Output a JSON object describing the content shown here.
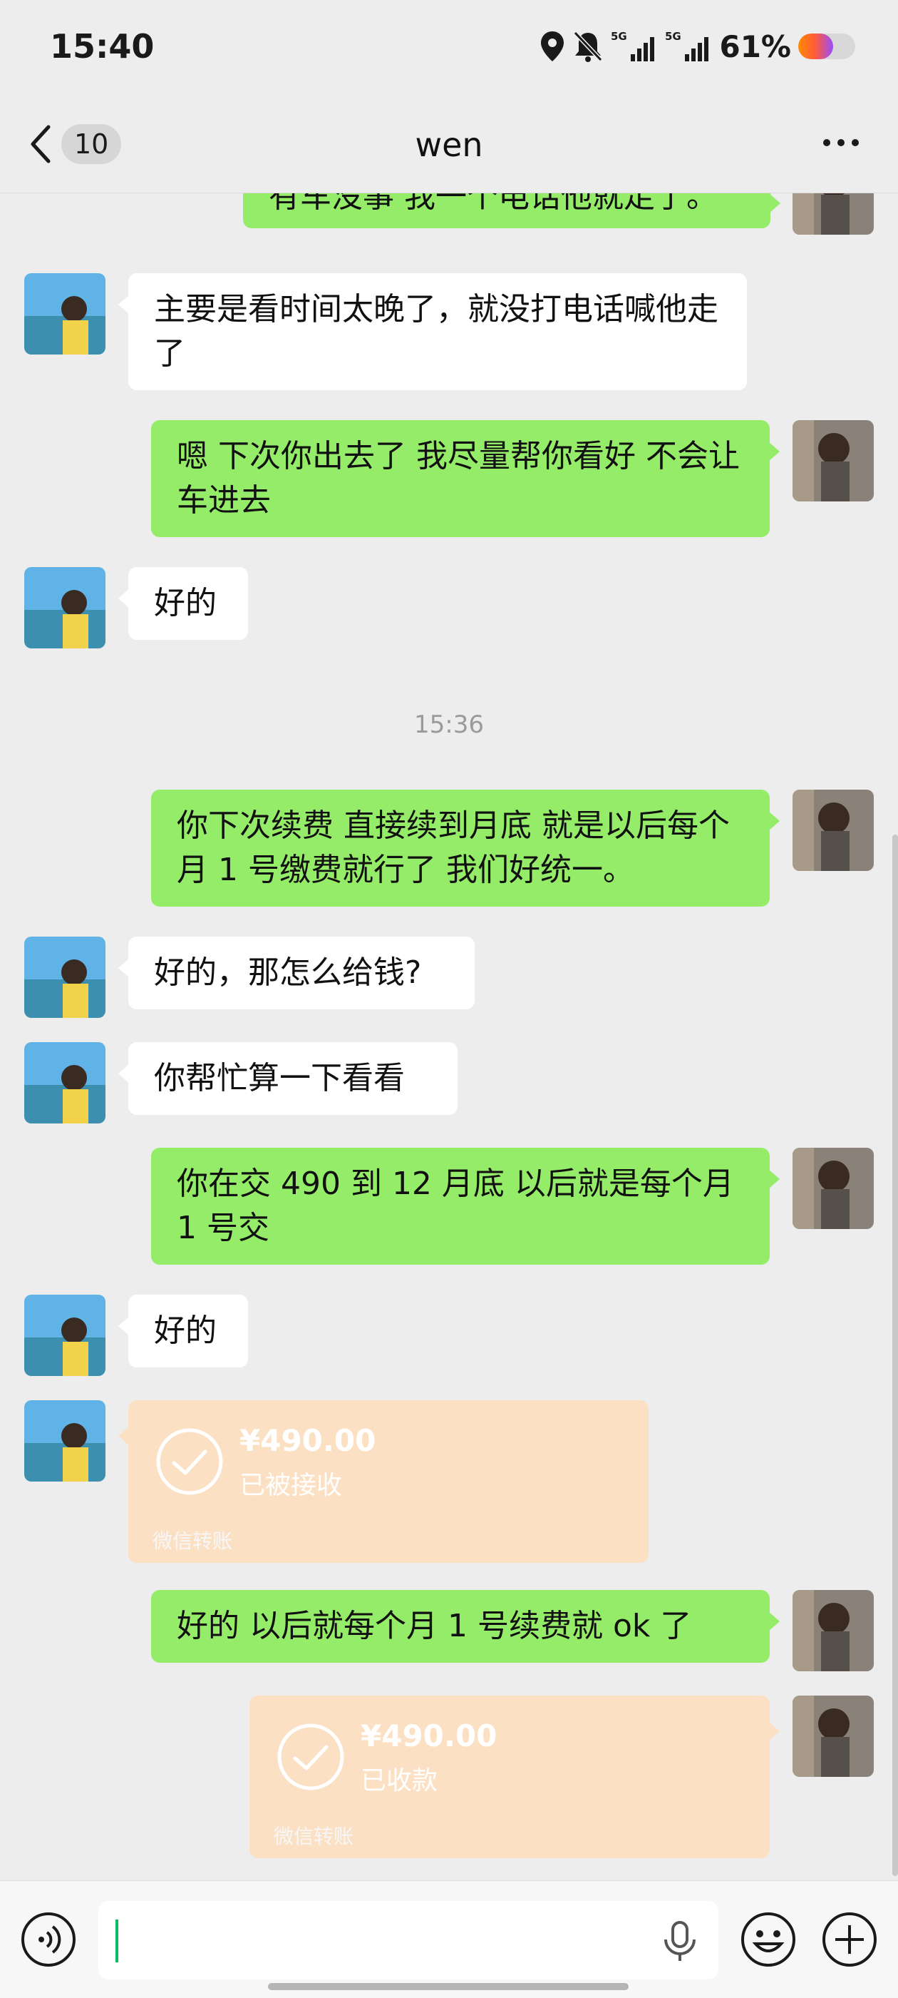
{
  "status": {
    "time": "15:40",
    "battery": "61%",
    "battery_level": 0.61,
    "signal1": "5G",
    "signal2": "5G"
  },
  "nav": {
    "back_count": "10",
    "title": "wen"
  },
  "messages": [
    {
      "side": "out",
      "text": "有车没事 我一个电话他就走了。"
    },
    {
      "side": "in",
      "text": "主要是看时间太晚了，就没打电话喊他走了"
    },
    {
      "side": "out",
      "text": "嗯  下次你出去了  我尽量帮你看好  不会让车进去"
    },
    {
      "side": "in",
      "text": "好的"
    },
    {
      "side": "out",
      "text": "你下次续费  直接续到月底  就是以后每个月 1 号缴费就行了  我们好统一。"
    },
    {
      "side": "in",
      "text": "好的，那怎么给钱?"
    },
    {
      "side": "in",
      "text": "你帮忙算一下看看"
    },
    {
      "side": "out",
      "text": "你在交 490  到 12 月底  以后就是每个月 1 号交"
    },
    {
      "side": "in",
      "text": "好的"
    },
    {
      "side": "out",
      "text": "好的  以后就每个月 1 号续费就 ok 了"
    }
  ],
  "timestamp": "15:36",
  "transfers": [
    {
      "side": "in",
      "amount": "¥490.00",
      "status": "已被接收",
      "footer": "微信转账"
    },
    {
      "side": "out",
      "amount": "¥490.00",
      "status": "已收款",
      "footer": "微信转账"
    }
  ],
  "input": {
    "value": ""
  },
  "colors": {
    "background": "#ededed",
    "outgoing_bubble": "#95ec69",
    "incoming_bubble": "#ffffff",
    "transfer_card": "#fce0c4",
    "accent": "#07c160"
  },
  "icons": [
    "location-icon",
    "bell-off-icon",
    "signal-icon",
    "battery-icon",
    "back-chevron-icon",
    "more-icon",
    "voice-icon",
    "microphone-icon",
    "emoji-icon",
    "plus-icon",
    "check-circle-icon"
  ]
}
